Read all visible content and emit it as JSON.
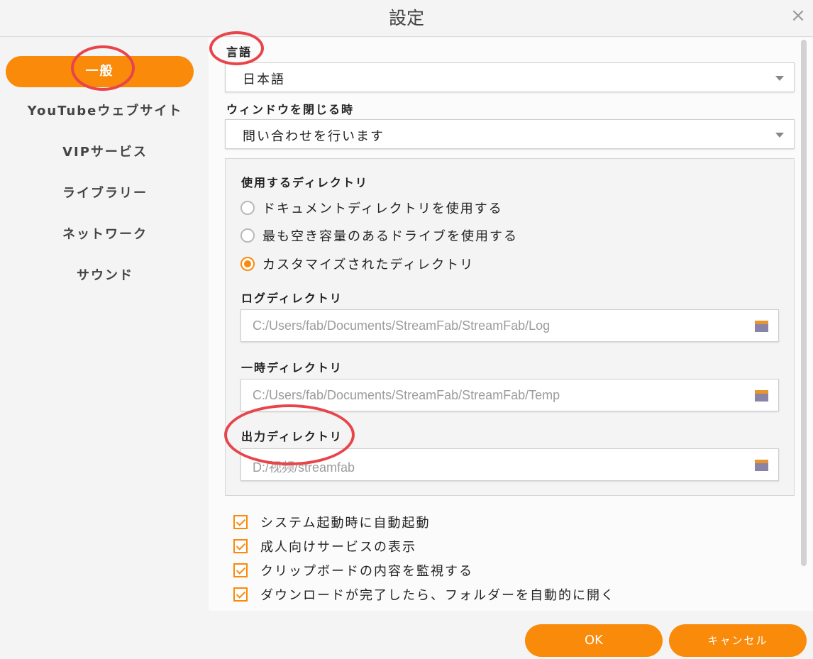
{
  "window": {
    "title": "設定",
    "close_symbol": "×"
  },
  "sidebar": {
    "items": [
      {
        "label": "一般",
        "active": true
      },
      {
        "label": "YouTubeウェブサイト",
        "active": false
      },
      {
        "label": "VIPサービス",
        "active": false
      },
      {
        "label": "ライブラリー",
        "active": false
      },
      {
        "label": "ネットワーク",
        "active": false
      },
      {
        "label": "サウンド",
        "active": false
      }
    ]
  },
  "language": {
    "label": "言語",
    "value": "日本語"
  },
  "on_close": {
    "label": "ウィンドウを閉じる時",
    "value": "問い合わせを行います"
  },
  "directory": {
    "label": "使用するディレクトリ",
    "options": [
      {
        "label": "ドキュメントディレクトリを使用する",
        "selected": false
      },
      {
        "label": "最も空き容量のあるドライブを使用する",
        "selected": false
      },
      {
        "label": "カスタマイズされたディレクトリ",
        "selected": true
      }
    ],
    "log": {
      "label": "ログディレクトリ",
      "value": "C:/Users/fab/Documents/StreamFab/StreamFab/Log"
    },
    "temp": {
      "label": "一時ディレクトリ",
      "value": "C:/Users/fab/Documents/StreamFab/StreamFab/Temp"
    },
    "output": {
      "label": "出力ディレクトリ",
      "value": "D:/视频/streamfab"
    }
  },
  "checkboxes": [
    {
      "label": "システム起動時に自動起動",
      "checked": true
    },
    {
      "label": "成人向けサービスの表示",
      "checked": true
    },
    {
      "label": "クリップボードの内容を監視する",
      "checked": true
    },
    {
      "label": "ダウンロードが完了したら、フォルダーを自動的に開く",
      "checked": true
    }
  ],
  "buttons": {
    "ok": "OK",
    "cancel": "キャンセル"
  },
  "colors": {
    "accent": "#f98a0a",
    "annotation": "#e8454b",
    "folder_top": "#e9952a",
    "folder_body": "#8a83a8"
  }
}
